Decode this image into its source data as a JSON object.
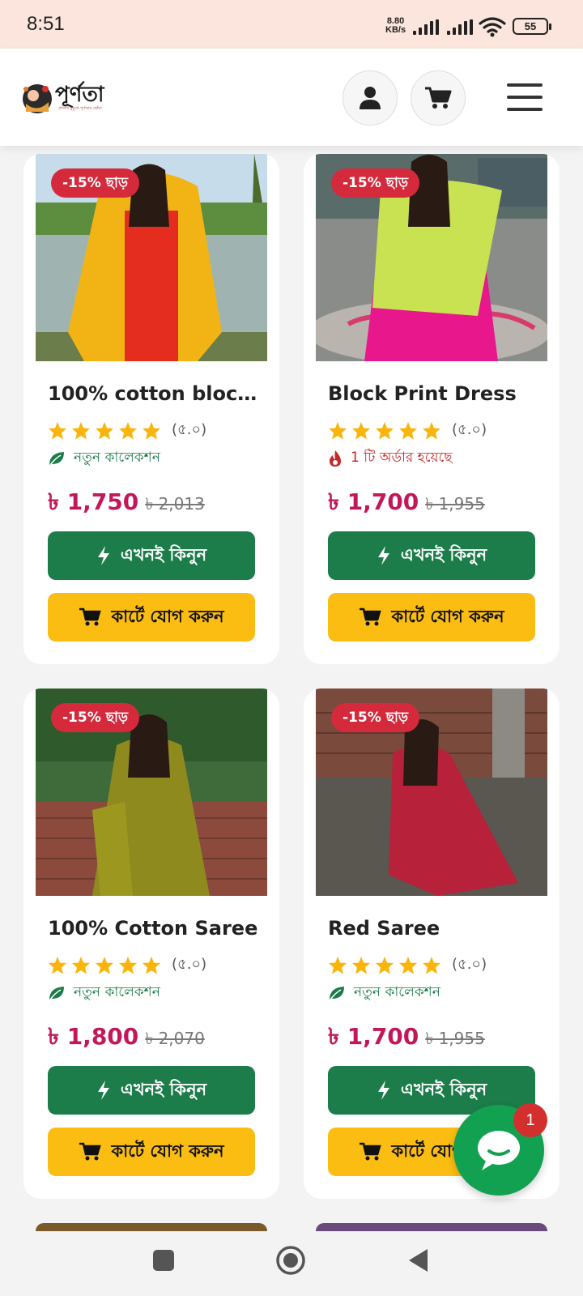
{
  "status_bar": {
    "time": "8:51",
    "network_speed_value": "8.80",
    "network_speed_unit": "KB/s",
    "battery": "55"
  },
  "header": {
    "logo_text": "পূর্ণতা",
    "logo_tagline": "প্রতিটি মুহূর্তে পূর্ণতার ছোঁয়া",
    "icons": [
      "user-icon",
      "cart-icon",
      "menu-icon"
    ]
  },
  "colors": {
    "badge": "#d42a3c",
    "price": "#c2185b",
    "buy_button": "#1c7c4a",
    "cart_button": "#fbbd12",
    "new_collection": "#1c7c4a",
    "orders_tag": "#c62828",
    "chat": "#12a150"
  },
  "products": [
    {
      "discount_badge": "-15% ছাড়",
      "title": "100% cotton block ...",
      "rating_stars": 5,
      "rating_text": "(৫.০)",
      "tag_type": "new",
      "tag_icon": "leaf-icon",
      "tag_text": "নতুন কালেকশন",
      "price": "৳ 1,750",
      "old_price": "৳ 2,013",
      "buy_label": "এখনই কিনুন",
      "cart_label": "কার্টে যোগ করুন",
      "image_desc": "yellow-red-outfit-photo"
    },
    {
      "discount_badge": "-15% ছাড়",
      "title": "Block Print Dress",
      "rating_stars": 5,
      "rating_text": "(৫.০)",
      "tag_type": "orders",
      "tag_icon": "fire-icon",
      "tag_text": "1 টি অর্ডার হয়েছে",
      "price": "৳ 1,700",
      "old_price": "৳ 1,955",
      "buy_label": "এখনই কিনুন",
      "cart_label": "কার্টে যোগ করুন",
      "image_desc": "pink-green-dress-photo"
    },
    {
      "discount_badge": "-15% ছাড়",
      "title": "100% Cotton Saree",
      "rating_stars": 5,
      "rating_text": "(৫.০)",
      "tag_type": "new",
      "tag_icon": "leaf-icon",
      "tag_text": "নতুন কালেকশন",
      "price": "৳ 1,800",
      "old_price": "৳ 2,070",
      "buy_label": "এখনই কিনুন",
      "cart_label": "কার্টে যোগ করুন",
      "image_desc": "olive-saree-photo"
    },
    {
      "discount_badge": "-15% ছাড়",
      "title": "Red Saree",
      "rating_stars": 5,
      "rating_text": "(৫.০)",
      "tag_type": "new",
      "tag_icon": "leaf-icon",
      "tag_text": "নতুন কালেকশন",
      "price": "৳ 1,700",
      "old_price": "৳ 1,955",
      "buy_label": "এখনই কিনুন",
      "cart_label": "কার্টে যোগ করুন",
      "image_desc": "red-saree-photo"
    }
  ],
  "chat": {
    "icon": "chat-icon",
    "badge_count": "1"
  },
  "nav_bar": {
    "icons": [
      "recents-icon",
      "home-icon",
      "back-icon"
    ]
  }
}
